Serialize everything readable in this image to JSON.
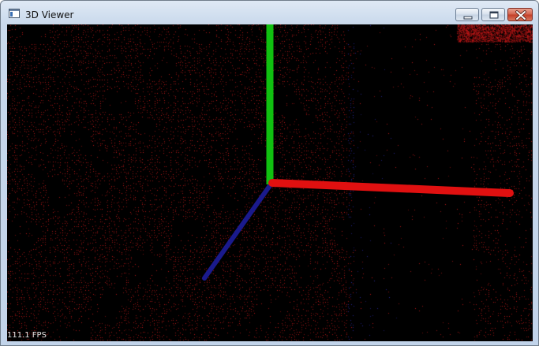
{
  "window": {
    "title": "3D Viewer",
    "icon": "app-window-icon",
    "buttons": {
      "minimize": "minimize-icon",
      "maximize": "maximize-icon",
      "close": "close-icon"
    }
  },
  "viewer": {
    "fps_text": "111.1 FPS",
    "background": "#000000",
    "axes": {
      "x_color": "#e01010",
      "y_color": "#10c010",
      "z_color": "#1a1a8c"
    },
    "points": {
      "primary_color": "#c01818",
      "secondary_color": "#2a2aa0"
    }
  }
}
